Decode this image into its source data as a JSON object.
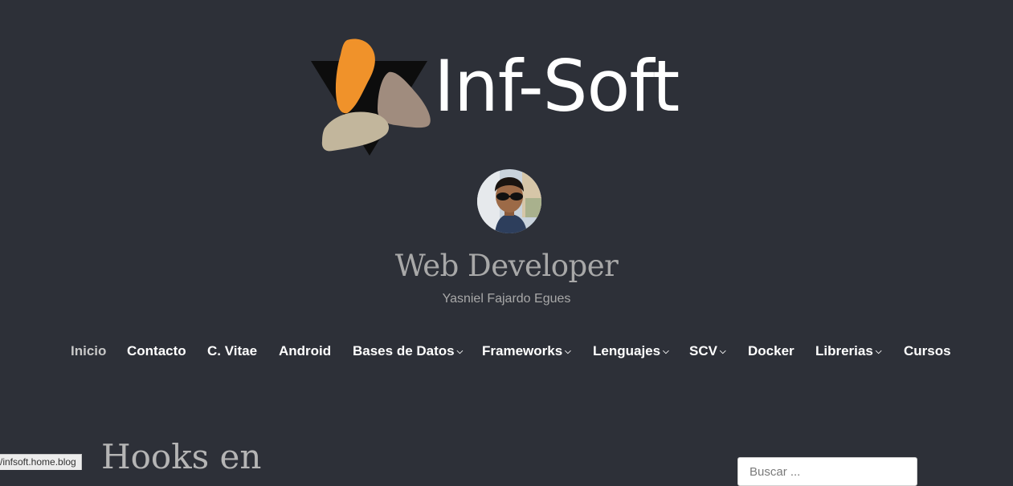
{
  "header": {
    "brand": "Inf-Soft",
    "title": "Web Developer",
    "subtitle": "Yasniel Fajardo Egues"
  },
  "nav": {
    "items": [
      {
        "label": "Inicio",
        "active": true,
        "dropdown": false
      },
      {
        "label": "Contacto",
        "active": false,
        "dropdown": false
      },
      {
        "label": "C. Vitae",
        "active": false,
        "dropdown": false
      },
      {
        "label": "Android",
        "active": false,
        "dropdown": false
      },
      {
        "label": "Bases de Datos",
        "active": false,
        "dropdown": true
      },
      {
        "label": "Frameworks",
        "active": false,
        "dropdown": true
      },
      {
        "label": "Lenguajes",
        "active": false,
        "dropdown": true
      },
      {
        "label": "SCV",
        "active": false,
        "dropdown": true
      },
      {
        "label": "Docker",
        "active": false,
        "dropdown": false
      },
      {
        "label": "Librerias",
        "active": false,
        "dropdown": true
      },
      {
        "label": "Cursos",
        "active": false,
        "dropdown": false
      }
    ],
    "chevron_glyph": "❯"
  },
  "post": {
    "title": "Hooks en"
  },
  "search": {
    "placeholder": "Buscar ..."
  },
  "status_bar": {
    "url": "/infsoft.home.blog"
  },
  "colors": {
    "background": "#2d3038",
    "text_primary": "#ffffff",
    "text_muted": "#a8a8a8",
    "logo_orange": "#f0922a",
    "logo_taupe": "#a08c7e",
    "logo_sand": "#c2b69c"
  }
}
